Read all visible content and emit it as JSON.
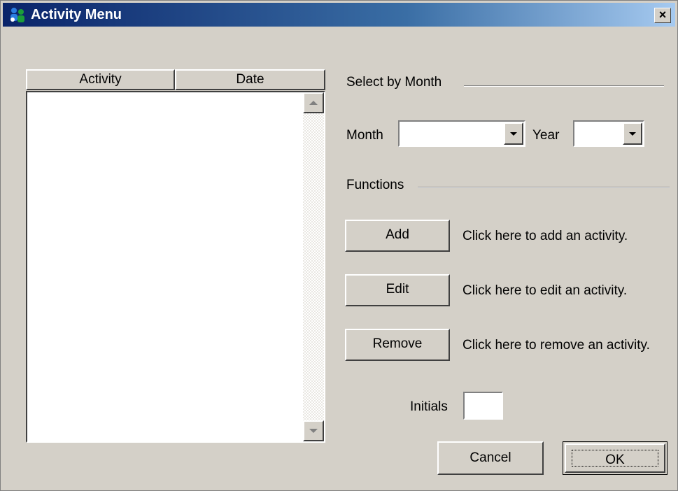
{
  "window": {
    "title": "Activity Menu",
    "close_label": "×"
  },
  "list": {
    "columns": [
      "Activity",
      "Date"
    ],
    "rows": []
  },
  "select_by_month": {
    "group_label": "Select by Month",
    "month_label": "Month",
    "month_value": "",
    "year_label": "Year",
    "year_value": ""
  },
  "functions": {
    "group_label": "Functions",
    "add_label": "Add",
    "add_hint": "Click here to add an activity.",
    "edit_label": "Edit",
    "edit_hint": "Click here to edit an activity.",
    "remove_label": "Remove",
    "remove_hint": "Click here to remove an activity."
  },
  "initials": {
    "label": "Initials",
    "value": ""
  },
  "footer": {
    "cancel_label": "Cancel",
    "ok_label": "OK"
  },
  "icons": {
    "app": "people-app-icon",
    "close": "close-icon",
    "scroll_up": "scroll-up-arrow-icon",
    "scroll_down": "scroll-down-arrow-icon",
    "dropdown": "dropdown-arrow-icon"
  },
  "colors": {
    "title_start": "#0a246a",
    "title_end": "#a6caf0",
    "face": "#d4d0c8"
  }
}
